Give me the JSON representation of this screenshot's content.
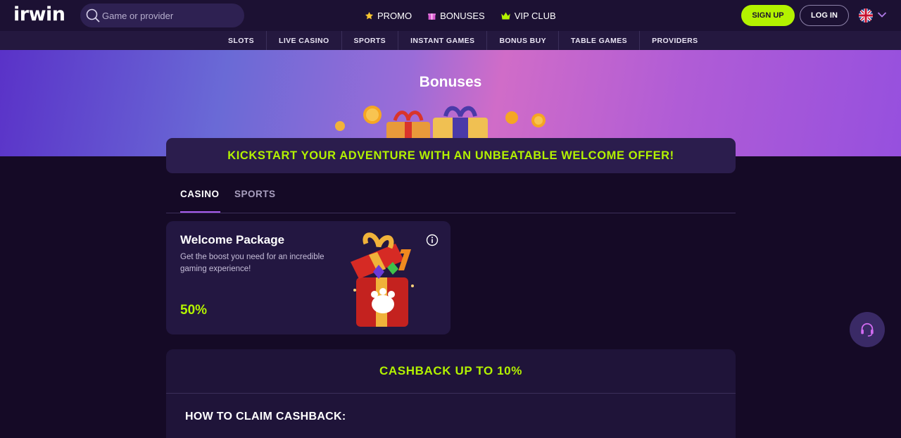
{
  "header": {
    "logo_text": "irwin",
    "search_placeholder": "Game or provider",
    "nav": [
      {
        "label": "PROMO",
        "icon": "star-icon"
      },
      {
        "label": "BONUSES",
        "icon": "gift-icon"
      },
      {
        "label": "VIP CLUB",
        "icon": "crown-icon"
      }
    ],
    "signup_label": "SIGN UP",
    "login_label": "LOG IN",
    "language_icon": "uk-flag-icon"
  },
  "categories": [
    "SLOTS",
    "LIVE CASINO",
    "SPORTS",
    "INSTANT GAMES",
    "BONUS BUY",
    "TABLE GAMES",
    "PROVIDERS"
  ],
  "hero": {
    "title": "Bonuses"
  },
  "banner": {
    "text": "KICKSTART YOUR ADVENTURE WITH AN UNBEATABLE WELCOME OFFER!"
  },
  "tabs": {
    "active": "CASINO",
    "inactive": "SPORTS"
  },
  "welcome_card": {
    "title": "Welcome Package",
    "description": "Get the boost you need for an incredible gaming experience!",
    "value": "50%"
  },
  "cashback": {
    "title": "CASHBACK UP TO 10%",
    "claim_heading": "HOW TO CLAIM CASHBACK:"
  },
  "colors": {
    "accent": "#b3f200",
    "background": "#150a26",
    "header": "#1c1133",
    "tab_underline": "#a95cf0"
  }
}
